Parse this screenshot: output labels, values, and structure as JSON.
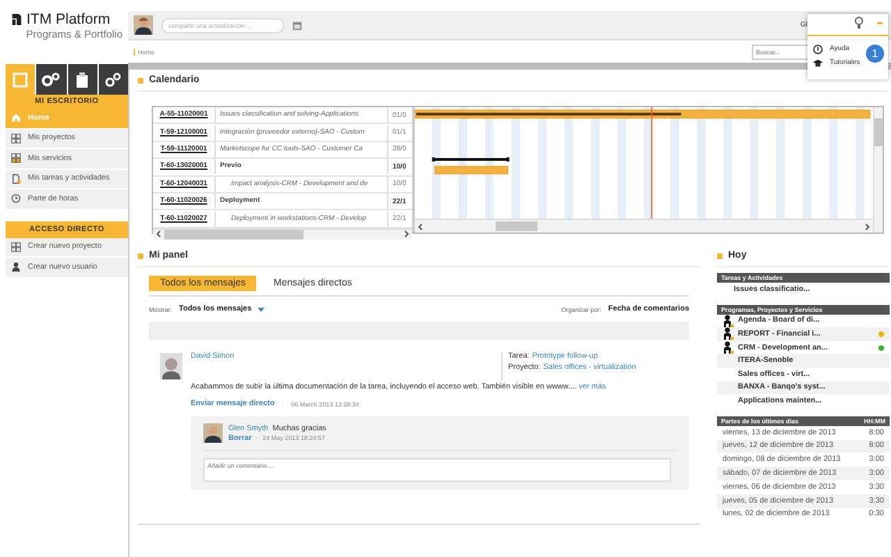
{
  "sidebar": {
    "logo": {
      "title": "ITM Platform",
      "subtitle": "Programs & Portfolio"
    },
    "tabs": [
      {
        "selected": true
      },
      {
        "selected": false
      },
      {
        "selected": false
      },
      {
        "selected": false
      }
    ],
    "section_title": "MI ESCRITORIO",
    "items": [
      {
        "label": "Home",
        "selected": true
      },
      {
        "label": "Mis proyectos",
        "selected": false
      },
      {
        "label": "Mis servicios",
        "selected": false
      },
      {
        "label": "Mis tareas y actividades",
        "selected": false
      },
      {
        "label": "Parte de horas",
        "selected": false
      }
    ],
    "shortcuts": {
      "title": "ACCESO DIRECTO",
      "items": [
        "Crear nuevo proyecto",
        "Crear nuevo usuario"
      ]
    }
  },
  "topbar": {
    "share_field": {
      "placeholder": "compartir una actualización ..."
    },
    "user_name": "Gl"
  },
  "breadcrumb": "Home",
  "search": {
    "placeholder": "Buscar..."
  },
  "help_menu": {
    "items": [
      "Ayuda",
      "Tutoriales"
    ],
    "badge": "1"
  },
  "calendar": {
    "title": "Calendario",
    "rows": [
      {
        "code": "A-55-11020001",
        "name": "Issues classification and solving-Applications",
        "date": "01/0"
      },
      {
        "code": "T-59-12100001",
        "name": "Integración (proveedor externo)-SAO - Custom",
        "date": "01/1"
      },
      {
        "code": "T-59-11120001",
        "name": "Marketscope for CC tools-SAO - Customer Ca",
        "date": "28/0"
      },
      {
        "code": "T-60-13020001",
        "name": "Previo",
        "date": "10/0",
        "children": [
          {
            "code": "T-60-12040031",
            "name": "Impact analysis-CRM - Development and de",
            "date": "10/0"
          }
        ]
      },
      {
        "code": "T-60-11020026",
        "name": "Deployment",
        "date": "22/1",
        "children": [
          {
            "code": "T-60-11020027",
            "name": "Deployment in workstations-CRM - Develop",
            "date": "22/1"
          }
        ]
      }
    ]
  },
  "panel": {
    "title": "Mi panel",
    "tabs": [
      {
        "label": "Todos los mensajes",
        "selected": true
      },
      {
        "label": "Mensajes directos",
        "selected": false
      }
    ],
    "filter": {
      "show_label": "Mostrar:",
      "show_value": "Todos los mensajes",
      "sort_label": "Organizar por:",
      "sort_value": "Fecha de comentarios"
    },
    "post": {
      "author": "David Simon",
      "task_label": "Tarea:",
      "task": "Prototype follow-up",
      "project_label": "Proyecto:",
      "project": "Sales offices - virtualization",
      "body": "Acabammos de subir la última documentación de la tarea, incluyendo el acceso web. También visible en wwww....",
      "more": "ver más",
      "action": "Enviar mensaje directo",
      "separator": "·",
      "time": "06 March 2013 13:39:34",
      "comment": {
        "author": "Glen Smyth",
        "text": "Muchas gracias",
        "action": "Borrar",
        "separator": "·",
        "time": "24 May 2013 18:24:57"
      },
      "comment_field": {
        "placeholder": "Añadir un comentario ..."
      }
    }
  },
  "today": {
    "title": "Hoy",
    "tasks": {
      "title": "Tareas y Actividades",
      "items": [
        "Issues classificatio..."
      ]
    },
    "programs": {
      "title": "Programas, Proyectos y Servicios",
      "items": [
        {
          "name": "Agenda - Board of di...",
          "kind": "person"
        },
        {
          "name": "REPORT - Financial i...",
          "kind": "person",
          "color": "#f0b400"
        },
        {
          "name": "CRM - Development an...",
          "kind": "person",
          "color": "#3cb43c"
        },
        {
          "name": "ITERA-Senoble",
          "kind": "plain"
        },
        {
          "name": "Sales offices - virt...",
          "kind": "plain"
        },
        {
          "name": "BANXA - Banqo's syst...",
          "kind": "plain"
        },
        {
          "name": "Applications mainten...",
          "kind": "plain"
        }
      ]
    },
    "timesheets": {
      "title": "Partes de los últimos días",
      "column": "HH:MM",
      "rows": [
        {
          "date": "viernes, 13 de diciembre de 2013",
          "hours": "8:00"
        },
        {
          "date": "jueves, 12 de diciembre de 2013",
          "hours": "8:00"
        },
        {
          "date": "domingo, 08 de diciembre de 2013",
          "hours": "3:00"
        },
        {
          "date": "sábado, 07 de diciembre de 2013",
          "hours": "3:00"
        },
        {
          "date": "viernes, 06 de diciembre de 2013",
          "hours": "3:30"
        },
        {
          "date": "jueves, 05 de diciembre de 2013",
          "hours": "3:30"
        },
        {
          "date": "lunes, 02 de diciembre de 2013",
          "hours": "0:30"
        }
      ]
    }
  }
}
